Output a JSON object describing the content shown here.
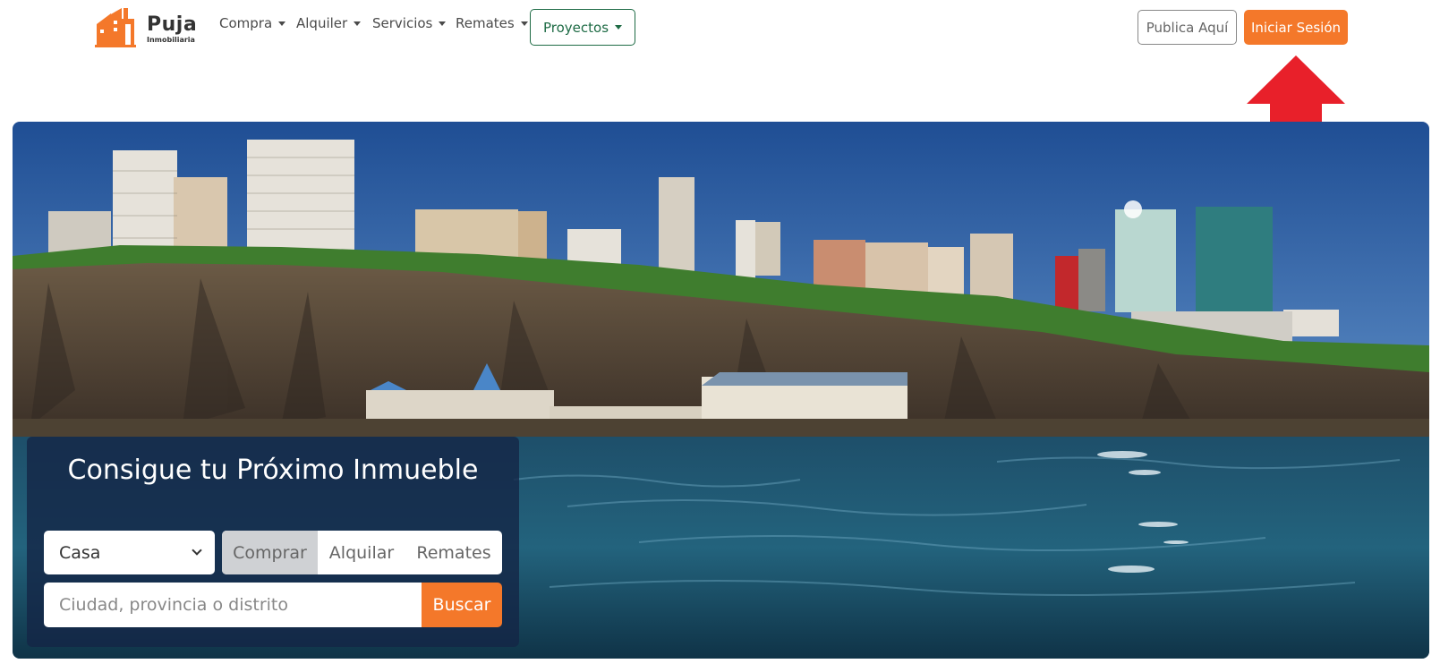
{
  "brand": {
    "name": "Puja",
    "tagline": "Inmobiliaria",
    "accent_color": "#f4782a",
    "project_color": "#1e6b45"
  },
  "nav": {
    "items": [
      {
        "label": "Compra",
        "icon": "caret-down-icon"
      },
      {
        "label": "Alquiler",
        "icon": "caret-down-icon"
      },
      {
        "label": "Servicios",
        "icon": "caret-down-icon"
      },
      {
        "label": "Remates",
        "icon": "caret-down-icon"
      },
      {
        "label": "Proyectos",
        "icon": "caret-down-icon"
      }
    ],
    "publica_label": "Publica Aquí",
    "login_label": "Iniciar Sesión"
  },
  "annotation": {
    "icon": "up-arrow-icon",
    "color": "#e8202a"
  },
  "hero": {
    "image": "coastal-city-cliffs-ocean"
  },
  "search": {
    "title": "Consigue tu Próximo Inmueble",
    "property_type": "Casa",
    "modes": [
      "Comprar",
      "Alquilar",
      "Remates"
    ],
    "active_mode": "Comprar",
    "placeholder": "Ciudad, provincia o distrito",
    "button_label": "Buscar"
  }
}
